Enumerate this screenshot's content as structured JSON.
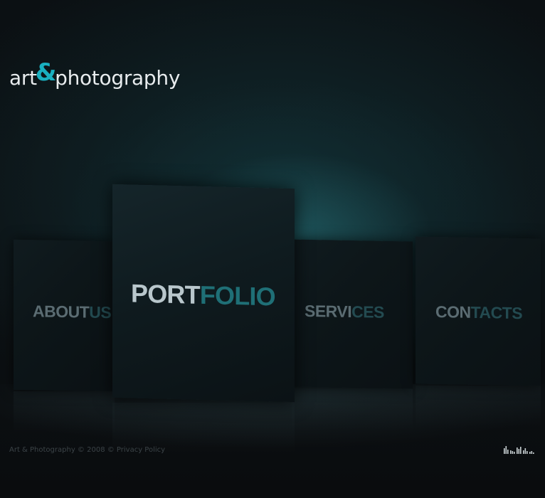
{
  "logo": {
    "part1": "art",
    "amp": "&",
    "part2": "photography"
  },
  "nav": {
    "about": {
      "a": "ABOUT",
      "b": "US"
    },
    "portfolio": {
      "a": "PORT",
      "b": "FOLIO"
    },
    "services": {
      "a": "SERVI",
      "b": "CES"
    },
    "contacts": {
      "a": "CON",
      "b": "TACTS"
    }
  },
  "footer": {
    "copyright": "Art & Photography © 2008 ©",
    "privacy": "Privacy Policy"
  },
  "colors": {
    "accent": "#19b0c0",
    "background": "#0a0c0e"
  },
  "icons": {
    "sound": "sound-equalizer-icon"
  }
}
